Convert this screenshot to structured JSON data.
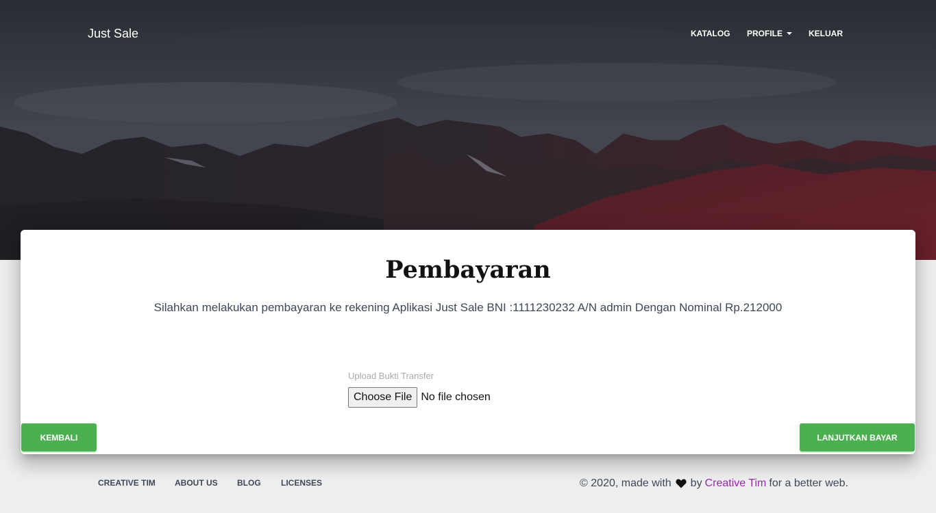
{
  "navbar": {
    "brand": "Just Sale",
    "links": [
      "KATALOG",
      "PROFILE",
      "KELUAR"
    ]
  },
  "card": {
    "title": "Pembayaran",
    "description": "Silahkan melakukan pembayaran ke rekening Aplikasi Just Sale BNI :1111230232 A/N admin Dengan Nominal Rp.212000",
    "upload_label": "Upload Bukti Transfer",
    "file_button": "Choose File",
    "file_status": "No file chosen",
    "back_button": "KEMBALI",
    "next_button": "LANJUTKAN BAYAR"
  },
  "footer": {
    "links": [
      "CREATIVE TIM",
      "ABOUT US",
      "BLOG",
      "LICENSES"
    ],
    "copyright_prefix": "© 2020, made with",
    "copyright_by": "by",
    "copyright_link": "Creative Tim",
    "copyright_suffix": "for a better web."
  },
  "colors": {
    "primary_green": "#4caf50",
    "link_purple": "#9c27b0",
    "background": "#eeeeee"
  },
  "icons": {
    "heart": "heart-icon",
    "dropdown": "caret-down-icon"
  }
}
